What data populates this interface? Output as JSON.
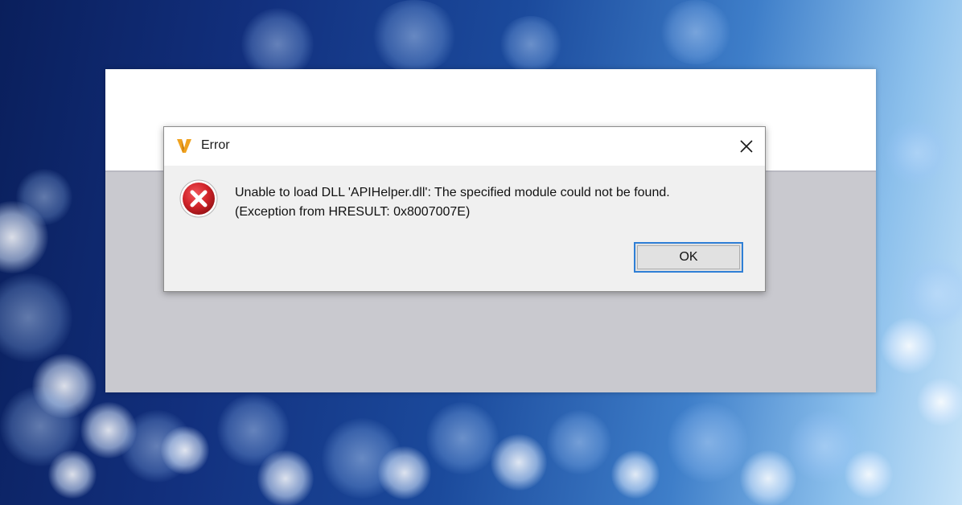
{
  "dialog": {
    "title": "Error",
    "app_icon": "vendor-logo-icon",
    "close_icon": "close-icon",
    "status_icon": "error-icon",
    "message": "Unable to load DLL 'APIHelper.dll': The specified module could not be found. (Exception from HRESULT: 0x8007007E)",
    "ok_label": "OK"
  },
  "colors": {
    "accent": "#2f7fd6",
    "error_red": "#d1242a",
    "logo_orange": "#f0a21e"
  }
}
